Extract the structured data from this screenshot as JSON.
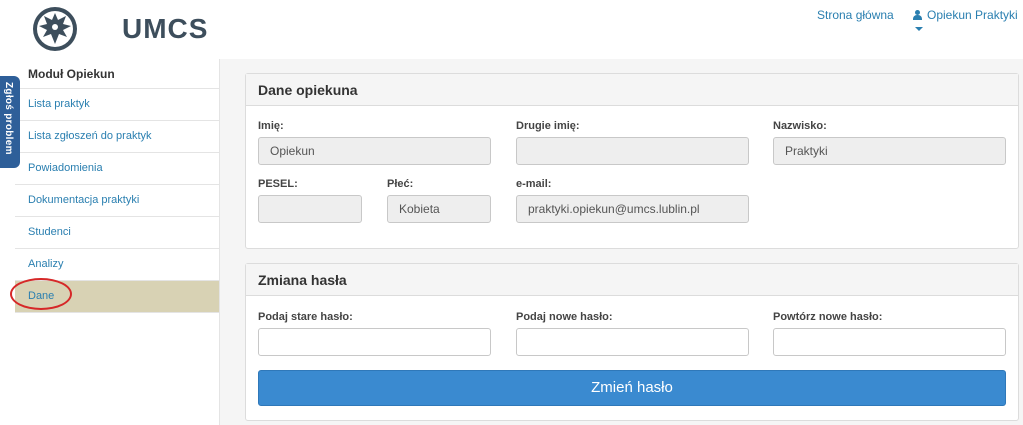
{
  "header": {
    "logo_text": "UMCS",
    "nav_home": "Strona główna",
    "nav_user": "Opiekun Praktyki"
  },
  "side_tab": {
    "label": "Zgłoś problem"
  },
  "sidebar": {
    "title": "Moduł Opiekun",
    "items": [
      {
        "label": "Lista praktyk"
      },
      {
        "label": "Lista zgłoszeń do praktyk"
      },
      {
        "label": "Powiadomienia"
      },
      {
        "label": "Dokumentacja praktyki"
      },
      {
        "label": "Studenci"
      },
      {
        "label": "Analizy"
      },
      {
        "label": "Dane"
      }
    ],
    "active_item": "Dane"
  },
  "caregiver_panel": {
    "title": "Dane opiekuna",
    "first_name_label": "Imię:",
    "first_name_value": "Opiekun",
    "middle_name_label": "Drugie imię:",
    "middle_name_value": "",
    "last_name_label": "Nazwisko:",
    "last_name_value": "Praktyki",
    "pesel_label": "PESEL:",
    "pesel_value": "",
    "gender_label": "Płeć:",
    "gender_value": "Kobieta",
    "email_label": "e-mail:",
    "email_value": "praktyki.opiekun@umcs.lublin.pl"
  },
  "password_panel": {
    "title": "Zmiana hasła",
    "old_label": "Podaj stare hasło:",
    "new_label": "Podaj nowe hasło:",
    "repeat_label": "Powtórz nowe hasło:",
    "submit_label": "Zmień hasło"
  },
  "colors": {
    "link": "#2a7fb0",
    "active_sidebar": "#d8d2b4",
    "button": "#3a8ad0",
    "side_tab": "#2e5f99",
    "highlight_ellipse": "#d62828"
  }
}
